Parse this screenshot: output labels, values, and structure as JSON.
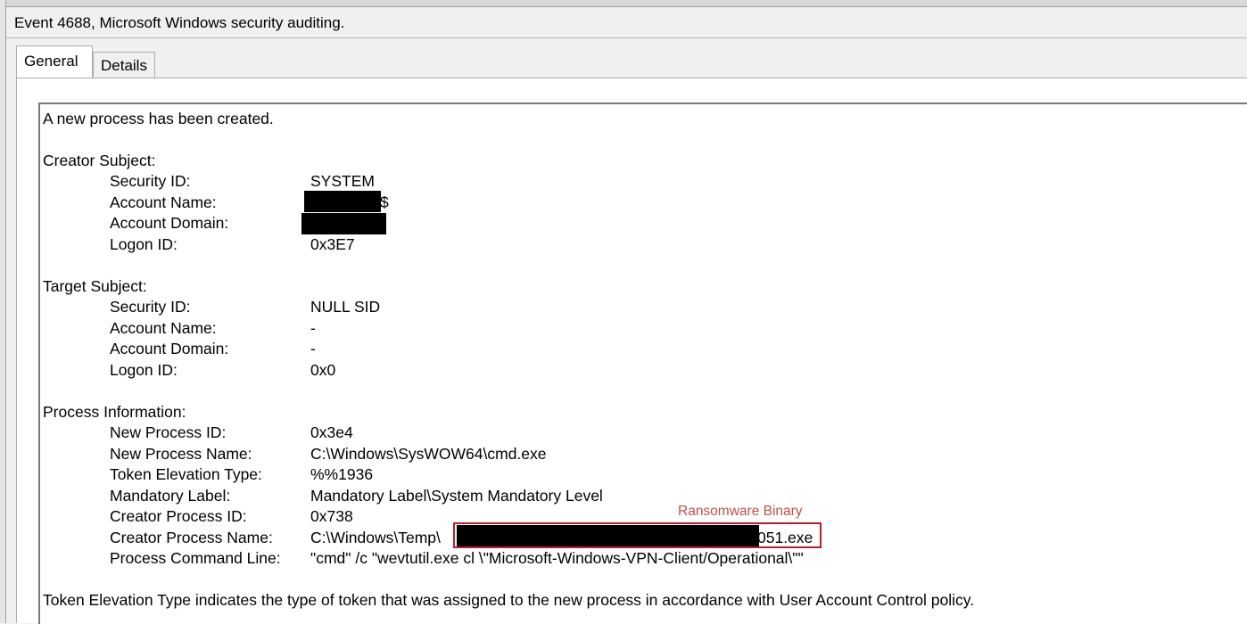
{
  "header": {
    "title": "Event 4688, Microsoft Windows security auditing."
  },
  "tabs": [
    {
      "label": "General",
      "active": true
    },
    {
      "label": "Details",
      "active": false
    }
  ],
  "event": {
    "intro": "A new process has been created.",
    "creator_subject": {
      "heading": "Creator Subject:",
      "security_id_label": "Security ID:",
      "security_id": "SYSTEM",
      "account_name_label": "Account Name:",
      "account_name_visible_suffix": "$",
      "account_domain_label": "Account Domain:",
      "logon_id_label": "Logon ID:",
      "logon_id": "0x3E7"
    },
    "target_subject": {
      "heading": "Target Subject:",
      "security_id_label": "Security ID:",
      "security_id": "NULL SID",
      "account_name_label": "Account Name:",
      "account_name": "-",
      "account_domain_label": "Account Domain:",
      "account_domain": "-",
      "logon_id_label": "Logon ID:",
      "logon_id": "0x0"
    },
    "process_information": {
      "heading": "Process Information:",
      "new_process_id_label": "New Process ID:",
      "new_process_id": "0x3e4",
      "new_process_name_label": "New Process Name:",
      "new_process_name": "C:\\Windows\\SysWOW64\\cmd.exe",
      "token_elevation_type_label": "Token Elevation Type:",
      "token_elevation_type": "%%1936",
      "mandatory_label_label": "Mandatory Label:",
      "mandatory_label": "Mandatory Label\\System Mandatory Level",
      "creator_process_id_label": "Creator Process ID:",
      "creator_process_id": "0x738",
      "creator_process_name_label": "Creator Process Name:",
      "creator_process_name_prefix": "C:\\Windows\\Temp\\",
      "creator_process_name_suffix": "051.exe",
      "process_command_line_label": "Process Command Line:",
      "process_command_line": "\"cmd\" /c \"wevtutil.exe cl \\\"Microsoft-Windows-VPN-Client/Operational\\\"\""
    },
    "footer_note": "Token Elevation Type indicates the type of token that was assigned to the new process in accordance with User Account Control policy."
  },
  "annotation": {
    "label": "Ransomware Binary",
    "color": "#c0504d",
    "box_color": "#b5202a"
  }
}
